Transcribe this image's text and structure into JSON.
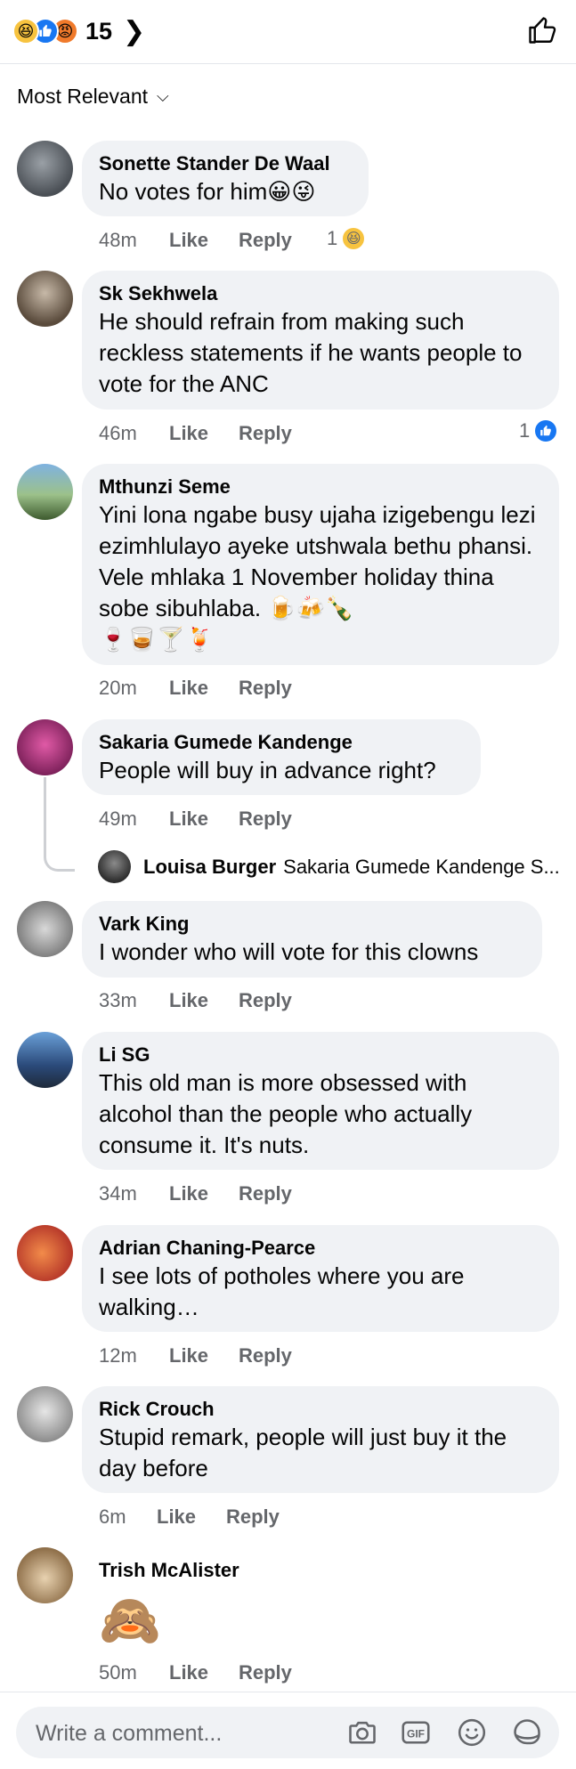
{
  "header": {
    "reaction_icons": [
      "haha",
      "like",
      "angry"
    ],
    "reaction_count": "15",
    "sort_label": "Most Relevant"
  },
  "comments": [
    {
      "author": "Sonette Stander De Waal",
      "text": "No votes for him😀😜",
      "time": "48m",
      "like": "Like",
      "reply": "Reply",
      "reaction_count": "1",
      "reaction": "😆"
    },
    {
      "author": "Sk Sekhwela",
      "text": "He should refrain from making such reckless statements if he wants people to vote for the ANC",
      "time": "46m",
      "like": "Like",
      "reply": "Reply",
      "reaction_count": "1",
      "reaction": "👍"
    },
    {
      "author": "Mthunzi Seme",
      "text": "Yini lona ngabe busy ujaha izigebengu lezi ezimhlulayo ayeke utshwala bethu phansi. Vele mhlaka 1 November holiday thina sobe sibuhlaba. 🍺🍻🍾",
      "text2": "🍷🥃🍸🍹",
      "time": "20m",
      "like": "Like",
      "reply": "Reply"
    },
    {
      "author": "Sakaria Gumede Kandenge",
      "text": "People will buy in advance right?",
      "time": "49m",
      "like": "Like",
      "reply": "Reply"
    },
    {
      "author": "Vark King",
      "text": "I wonder who will vote for this clowns",
      "time": "33m",
      "like": "Like",
      "reply": "Reply"
    },
    {
      "author": "Li SG",
      "text": "This old man is more obsessed with alcohol than the people who actually consume it. It's nuts.",
      "time": "34m",
      "like": "Like",
      "reply": "Reply"
    },
    {
      "author": "Adrian Chaning-Pearce",
      "text": "I see lots of potholes where you are walking…",
      "time": "12m",
      "like": "Like",
      "reply": "Reply"
    },
    {
      "author": "Rick Crouch",
      "text": "Stupid remark, people will just buy it the day before",
      "time": "6m",
      "like": "Like",
      "reply": "Reply"
    },
    {
      "author": "Trish McAlister",
      "text": "🙈",
      "time": "50m",
      "like": "Like",
      "reply": "Reply"
    }
  ],
  "reply_preview": {
    "author": "Louisa Burger",
    "text": "Sakaria Gumede Kandenge S..."
  },
  "composer": {
    "placeholder": "Write a comment...",
    "icons": [
      "camera-icon",
      "gif-icon",
      "emoji-icon",
      "sticker-icon"
    ]
  },
  "colors": {
    "bubble": "#f0f2f5",
    "meta": "#65676b",
    "like_blue": "#1877f2",
    "haha_yellow": "#f7c33f",
    "angry_orange": "#f07a2b"
  }
}
